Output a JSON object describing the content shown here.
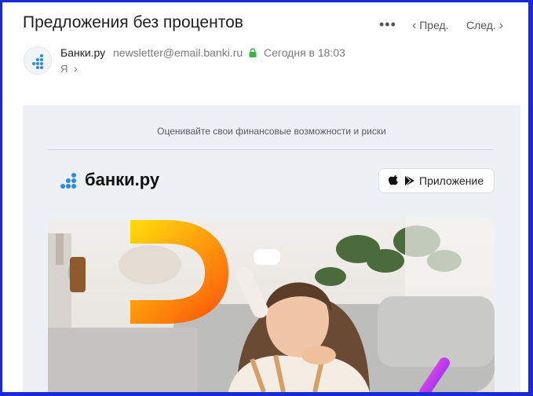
{
  "header": {
    "subject": "Предложения без процентов",
    "more_icon": "more-dots-icon",
    "prev_label": "Пред.",
    "next_label": "След."
  },
  "sender": {
    "name": "Банки.ру",
    "email": "newsletter@email.banki.ru",
    "date": "Сегодня в 18:03",
    "recipient": "Я",
    "lock_color": "#3bb54a"
  },
  "email": {
    "preheader": "Оценивайте свои финансовые возможности и риски",
    "logo_text": "банки.ру",
    "app_button_label": "Приложение",
    "brand_color": "#2a8be6"
  }
}
